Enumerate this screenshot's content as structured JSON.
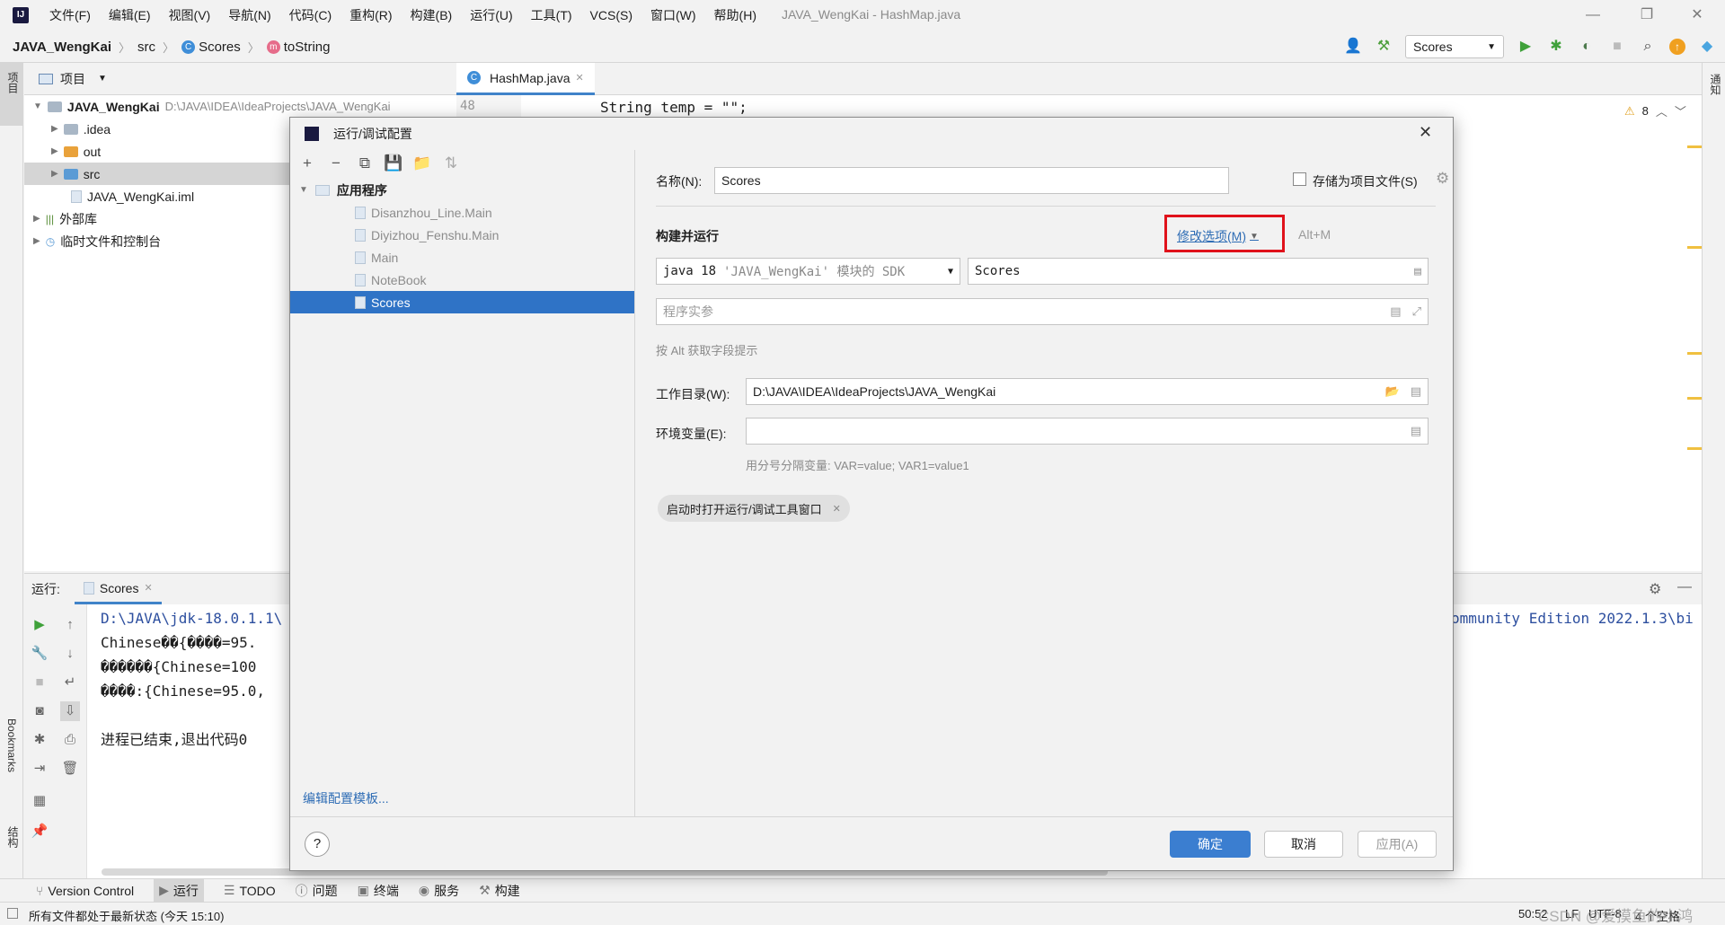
{
  "app": {
    "logo": "IJ",
    "window_title": "JAVA_WengKai - HashMap.java",
    "menu": [
      "文件(F)",
      "编辑(E)",
      "视图(V)",
      "导航(N)",
      "代码(C)",
      "重构(R)",
      "构建(B)",
      "运行(U)",
      "工具(T)",
      "VCS(S)",
      "窗口(W)",
      "帮助(H)"
    ]
  },
  "navbar": {
    "breadcrumb": [
      "JAVA_WengKai",
      "src",
      "Scores",
      "toString"
    ],
    "run_config": "Scores"
  },
  "left_stripe": {
    "project_tab": "项目",
    "bookmarks_tab": "Bookmarks",
    "structure_tab": "结构"
  },
  "right_stripe": {
    "notifications_tab": "通知"
  },
  "project_panel": {
    "title": "项目",
    "root": {
      "name": "JAVA_WengKai",
      "path": "D:\\JAVA\\IDEA\\IdeaProjects\\JAVA_WengKai"
    },
    "items": [
      ".idea",
      "out",
      "src",
      "JAVA_WengKai.iml",
      "外部库",
      "临时文件和控制台"
    ]
  },
  "editor": {
    "tab": "HashMap.java",
    "line_number": "48",
    "code_line": "String temp = \"\";",
    "warning_count": "8"
  },
  "run_panel": {
    "label": "运行:",
    "tab": "Scores",
    "console": [
      "D:\\JAVA\\jdk-18.0.1.1\\",
      "Chinese��{����=95.",
      "������{Chinese=100",
      "����:{Chinese=95.0,",
      "",
      "进程已结束,退出代码0"
    ],
    "console_right": "ommunity Edition 2022.1.3\\bi"
  },
  "bottom_bar": [
    "Version Control",
    "运行",
    "TODO",
    "问题",
    "终端",
    "服务",
    "构建"
  ],
  "status": {
    "message": "所有文件都处于最新状态 (今天 15:10)",
    "position": "50:52",
    "line_sep": "LF",
    "encoding": "UTF-8",
    "indent": "4 个空格",
    "watermark": "CSDN @爱摸鱼的小鸿"
  },
  "dialog": {
    "title": "运行/调试配置",
    "tree_root": "应用程序",
    "configs": [
      "Disanzhou_Line.Main",
      "Diyizhou_Fenshu.Main",
      "Main",
      "NoteBook",
      "Scores"
    ],
    "selected_config": "Scores",
    "edit_templates": "编辑配置模板...",
    "name_label": "名称(N):",
    "name_value": "Scores",
    "store_label": "存储为项目文件(S)",
    "build_run_label": "构建并运行",
    "modify_options": "修改选项(M)",
    "modify_shortcut": "Alt+M",
    "jdk_prefix": "java 18",
    "jdk_suffix": "'JAVA_WengKai' 模块的 SDK",
    "main_class": "Scores",
    "program_args_placeholder": "程序实参",
    "alt_hint": "按 Alt 获取字段提示",
    "workdir_label": "工作目录(W):",
    "workdir_value": "D:\\JAVA\\IDEA\\IdeaProjects\\JAVA_WengKai",
    "env_label": "环境变量(E):",
    "env_hint": "用分号分隔变量: VAR=value; VAR1=value1",
    "chip": "启动时打开运行/调试工具窗口",
    "ok": "确定",
    "cancel": "取消",
    "apply": "应用(A)",
    "help": "?"
  },
  "colors": {
    "accent": "#2f73c6",
    "highlight_box": "#e0121b",
    "link": "#2f6db5"
  }
}
